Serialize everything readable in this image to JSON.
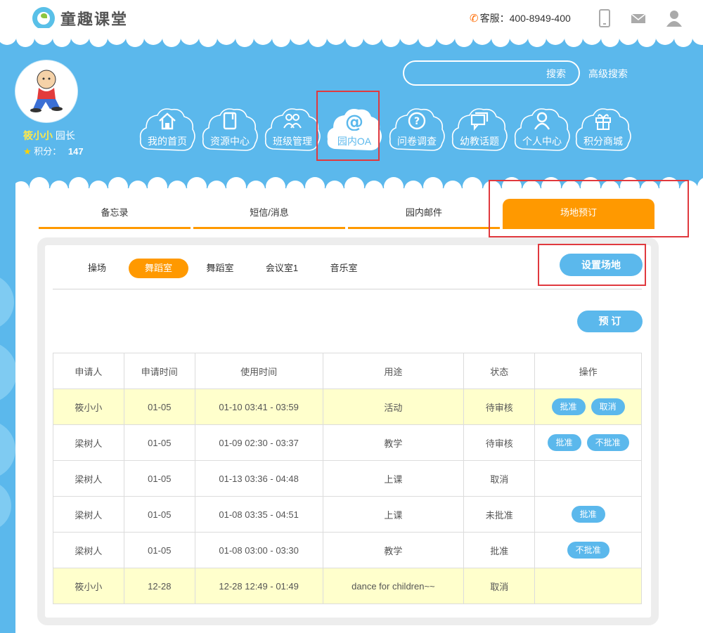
{
  "brand": {
    "name": "童趣课堂"
  },
  "header": {
    "hotline_label": "客服：",
    "hotline_number": "400-8949-400"
  },
  "user": {
    "name": "筱小小",
    "role": "园长",
    "points_label": "积分：",
    "points_value": "147"
  },
  "search": {
    "button": "搜索",
    "advanced": "高级搜索",
    "placeholder": ""
  },
  "nav": {
    "items": [
      {
        "label": "我的首页",
        "icon": "home-icon"
      },
      {
        "label": "资源中心",
        "icon": "document-icon"
      },
      {
        "label": "班级管理",
        "icon": "group-icon"
      },
      {
        "label": "园内OA",
        "icon": "at-icon",
        "active": true
      },
      {
        "label": "问卷调查",
        "icon": "question-icon"
      },
      {
        "label": "幼教话题",
        "icon": "chat-icon"
      },
      {
        "label": "个人中心",
        "icon": "person-icon"
      },
      {
        "label": "积分商城",
        "icon": "gift-icon"
      }
    ]
  },
  "tabs": [
    {
      "label": "备忘录"
    },
    {
      "label": "短信/消息"
    },
    {
      "label": "园内邮件"
    },
    {
      "label": "场地预订",
      "active": true
    }
  ],
  "rooms": [
    {
      "label": "操场"
    },
    {
      "label": "舞蹈室",
      "active": true
    },
    {
      "label": "舞蹈室"
    },
    {
      "label": "会议室1"
    },
    {
      "label": "音乐室"
    }
  ],
  "actions": {
    "setup_venue": "设置场地",
    "book": "预 订"
  },
  "table": {
    "headers": [
      "申请人",
      "申请时间",
      "使用时间",
      "用途",
      "状态",
      "操作"
    ],
    "rows": [
      {
        "applicant": "筱小小",
        "apply_date": "01-05",
        "use_time": "01-10 03:41 - 03:59",
        "purpose": "活动",
        "status": "待审核",
        "ops": [
          "批准",
          "取消"
        ],
        "highlight": true
      },
      {
        "applicant": "梁树人",
        "apply_date": "01-05",
        "use_time": "01-09 02:30 - 03:37",
        "purpose": "教学",
        "status": "待审核",
        "ops": [
          "批准",
          "不批准"
        ],
        "highlight": false
      },
      {
        "applicant": "梁树人",
        "apply_date": "01-05",
        "use_time": "01-13 03:36 - 04:48",
        "purpose": "上课",
        "status": "取消",
        "ops": [],
        "highlight": false
      },
      {
        "applicant": "梁树人",
        "apply_date": "01-05",
        "use_time": "01-08 03:35 - 04:51",
        "purpose": "上课",
        "status": "未批准",
        "ops": [
          "批准"
        ],
        "highlight": false
      },
      {
        "applicant": "梁树人",
        "apply_date": "01-05",
        "use_time": "01-08 03:00 - 03:30",
        "purpose": "教学",
        "status": "批准",
        "ops": [
          "不批准"
        ],
        "highlight": false
      },
      {
        "applicant": "筱小小",
        "apply_date": "12-28",
        "use_time": "12-28 12:49 - 01:49",
        "purpose": "dance for children~~",
        "status": "取消",
        "ops": [],
        "highlight": true
      }
    ]
  },
  "colors": {
    "sky": "#5bb8ec",
    "accent": "#ff9900",
    "highlight_row": "#ffffcc",
    "annotation": "#e0393e"
  }
}
